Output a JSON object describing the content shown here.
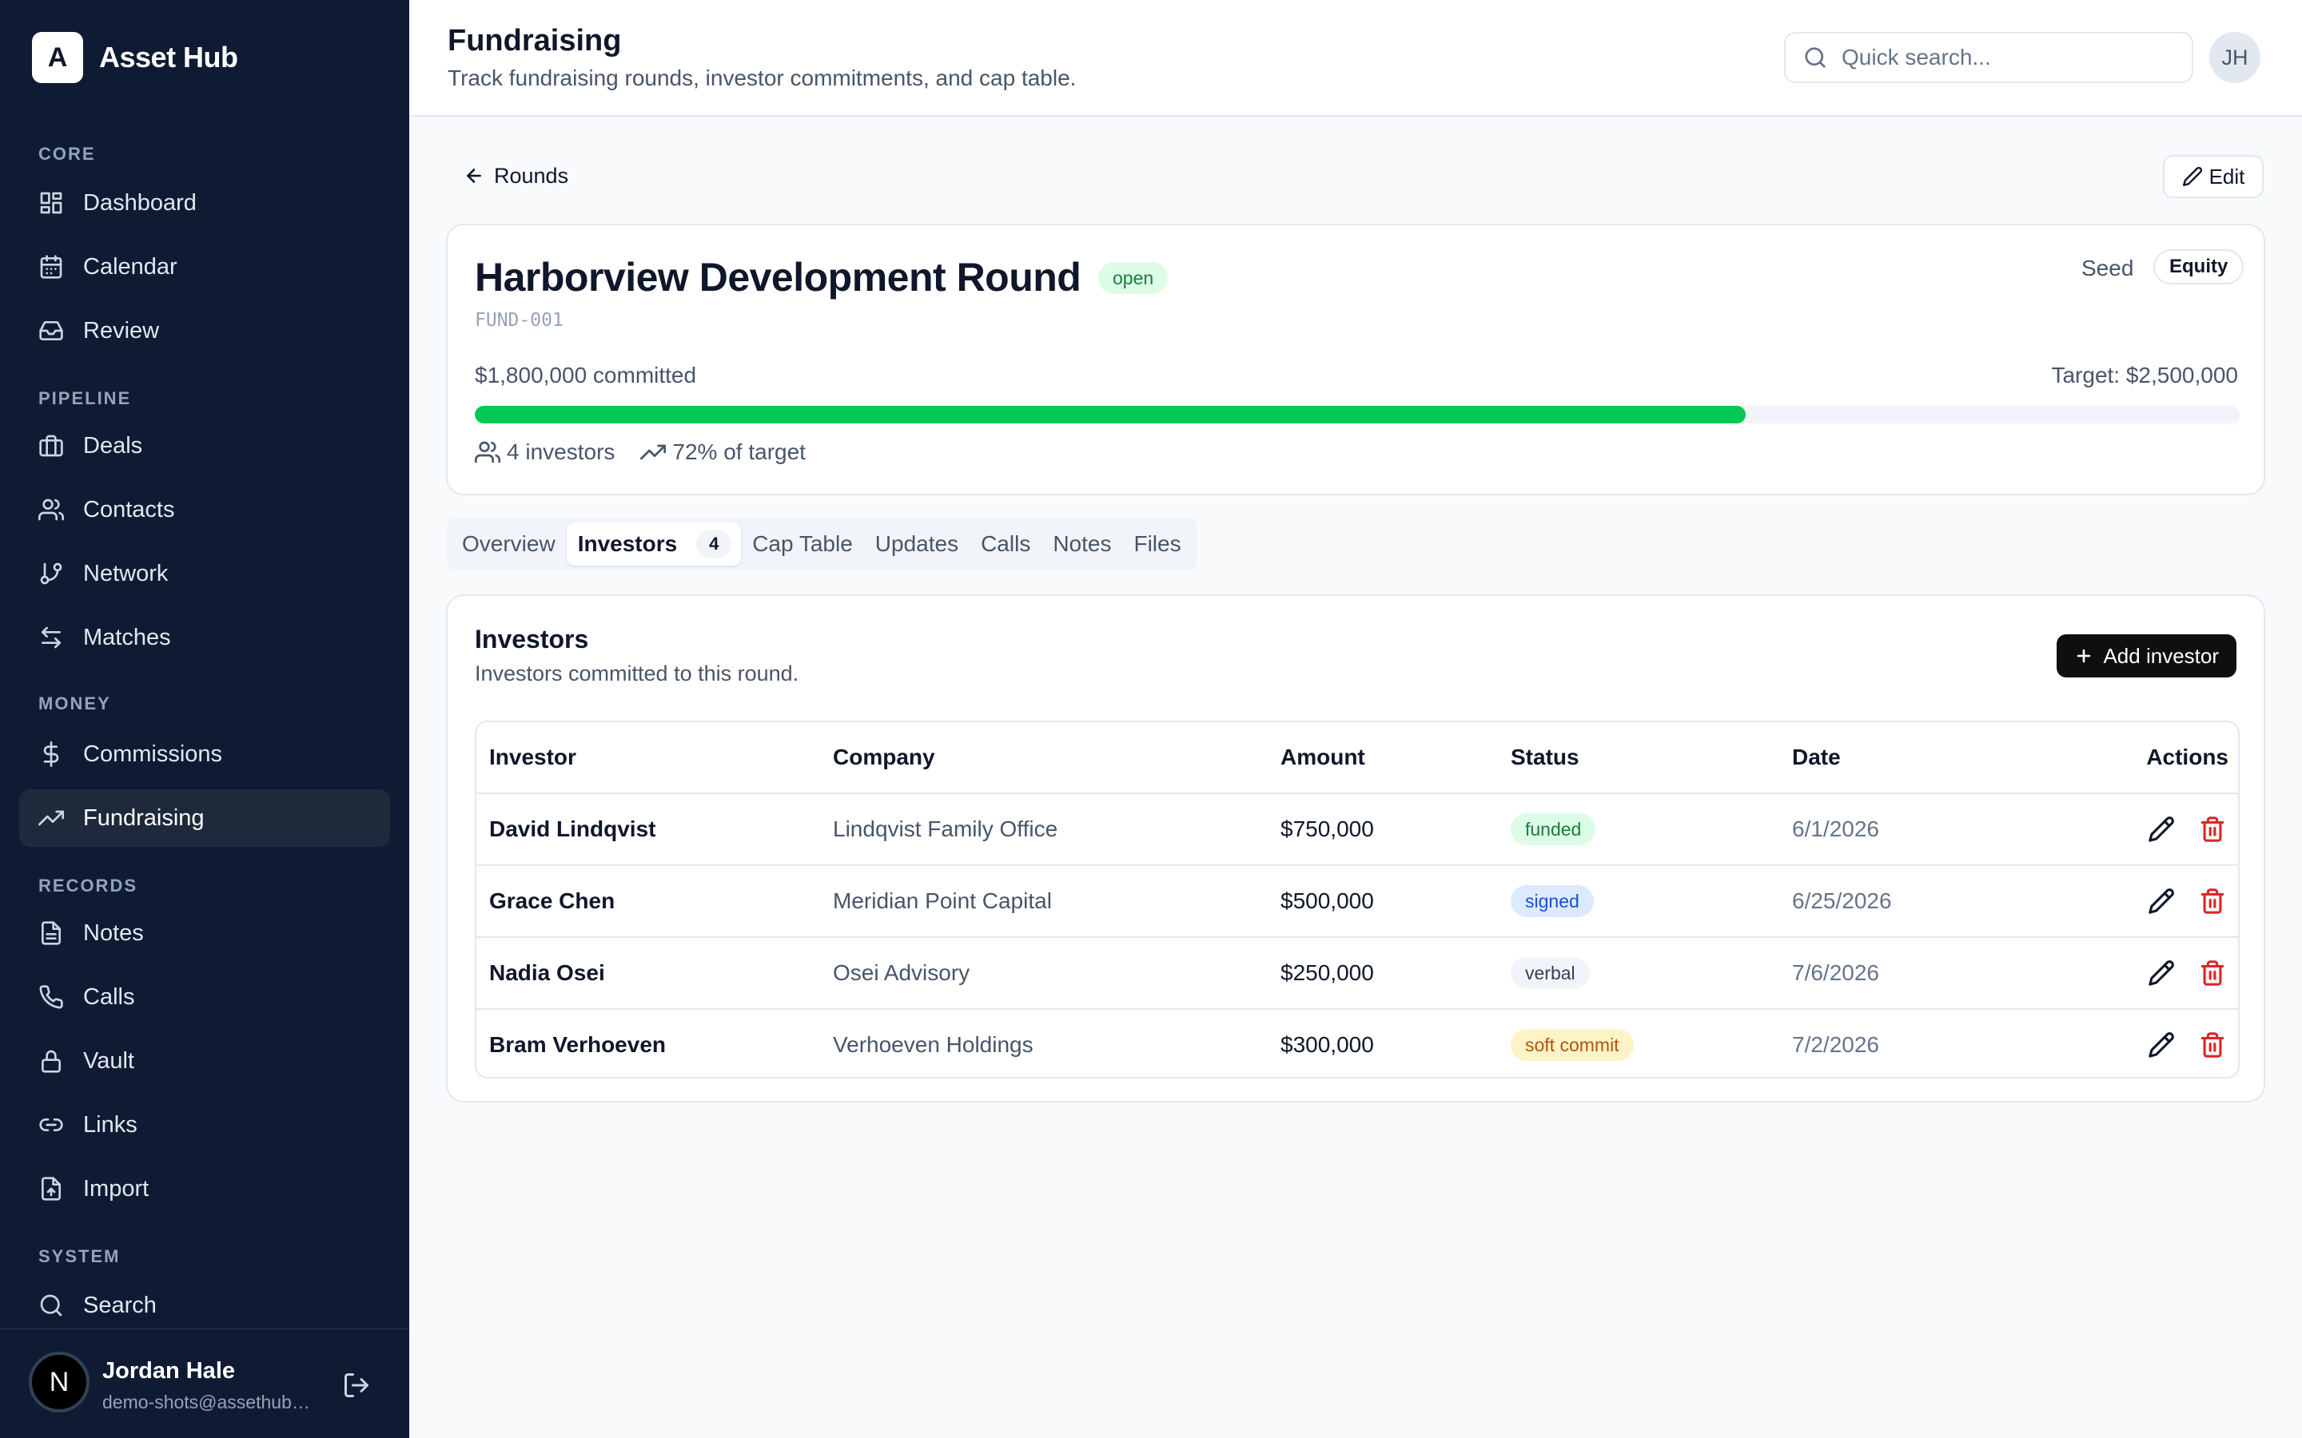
{
  "brand": {
    "logo_letter": "A",
    "name": "Asset Hub"
  },
  "sidebar": {
    "sections": {
      "core": "CORE",
      "pipeline": "PIPELINE",
      "money": "MONEY",
      "records": "RECORDS",
      "system": "SYSTEM"
    },
    "items": {
      "dashboard": "Dashboard",
      "calendar": "Calendar",
      "review": "Review",
      "deals": "Deals",
      "contacts": "Contacts",
      "network": "Network",
      "matches": "Matches",
      "commissions": "Commissions",
      "fundraising": "Fundraising",
      "notes": "Notes",
      "calls": "Calls",
      "vault": "Vault",
      "links": "Links",
      "import": "Import",
      "search": "Search"
    },
    "active_item": "Fundraising",
    "user": {
      "avatar_letter": "N",
      "name": "Jordan Hale",
      "email": "demo-shots@assethub.com"
    }
  },
  "header": {
    "title": "Fundraising",
    "subtitle": "Track fundraising rounds, investor commitments, and cap table.",
    "search_placeholder": "Quick search...",
    "avatar_initials": "JH"
  },
  "toolbar": {
    "back_label": "Rounds",
    "edit_label": "Edit"
  },
  "round": {
    "name": "Harborview Development Round",
    "status": "open",
    "code": "FUND-001",
    "stage": "Seed",
    "type": "Equity",
    "committed_label": "$1,800,000 committed",
    "target_label": "Target: $2,500,000",
    "progress_fraction": 0.72,
    "investors_label": "4 investors",
    "percent_label": "72% of target"
  },
  "tabs": [
    {
      "label": "Overview"
    },
    {
      "label": "Investors",
      "count": "4",
      "active": true
    },
    {
      "label": "Cap Table"
    },
    {
      "label": "Updates"
    },
    {
      "label": "Calls"
    },
    {
      "label": "Notes"
    },
    {
      "label": "Files"
    }
  ],
  "investors_panel": {
    "title": "Investors",
    "subtitle": "Investors committed to this round.",
    "add_label": "Add investor",
    "columns": {
      "investor": "Investor",
      "company": "Company",
      "amount": "Amount",
      "status": "Status",
      "date": "Date",
      "actions": "Actions"
    },
    "rows": [
      {
        "investor": "David Lindqvist",
        "company": "Lindqvist Family Office",
        "amount": "$750,000",
        "status": "funded",
        "date": "6/1/2026"
      },
      {
        "investor": "Grace Chen",
        "company": "Meridian Point Capital",
        "amount": "$500,000",
        "status": "signed",
        "date": "6/25/2026"
      },
      {
        "investor": "Nadia Osei",
        "company": "Osei Advisory",
        "amount": "$250,000",
        "status": "verbal",
        "date": "7/6/2026"
      },
      {
        "investor": "Bram Verhoeven",
        "company": "Verhoeven Holdings",
        "amount": "$300,000",
        "status": "soft commit",
        "date": "7/2/2026"
      }
    ]
  },
  "colors": {
    "sidebar_bg": "#0f1b33",
    "progress_fill": "#00c853",
    "status_funded_bg": "#dcfce7",
    "status_funded_fg": "#15803d",
    "status_signed_bg": "#dbeafe",
    "status_signed_fg": "#1d4ed8",
    "status_verbal_bg": "#f1f5f9",
    "status_verbal_fg": "#334155",
    "status_soft_bg": "#fef3c7",
    "status_soft_fg": "#b45309",
    "delete_icon": "#dc2626"
  },
  "icons": {
    "dashboard": "dashboard-icon",
    "calendar": "calendar-icon",
    "review": "inbox-icon",
    "deals": "briefcase-icon",
    "contacts": "users-icon",
    "network": "git-branch-icon",
    "matches": "arrows-left-right-icon",
    "commissions": "dollar-icon",
    "fundraising": "trending-up-icon",
    "notes": "file-text-icon",
    "calls": "phone-icon",
    "vault": "lock-icon",
    "links": "link-icon",
    "import": "file-upload-icon",
    "search": "search-icon",
    "logout": "logout-icon",
    "edit": "pencil-icon",
    "delete": "trash-icon"
  }
}
